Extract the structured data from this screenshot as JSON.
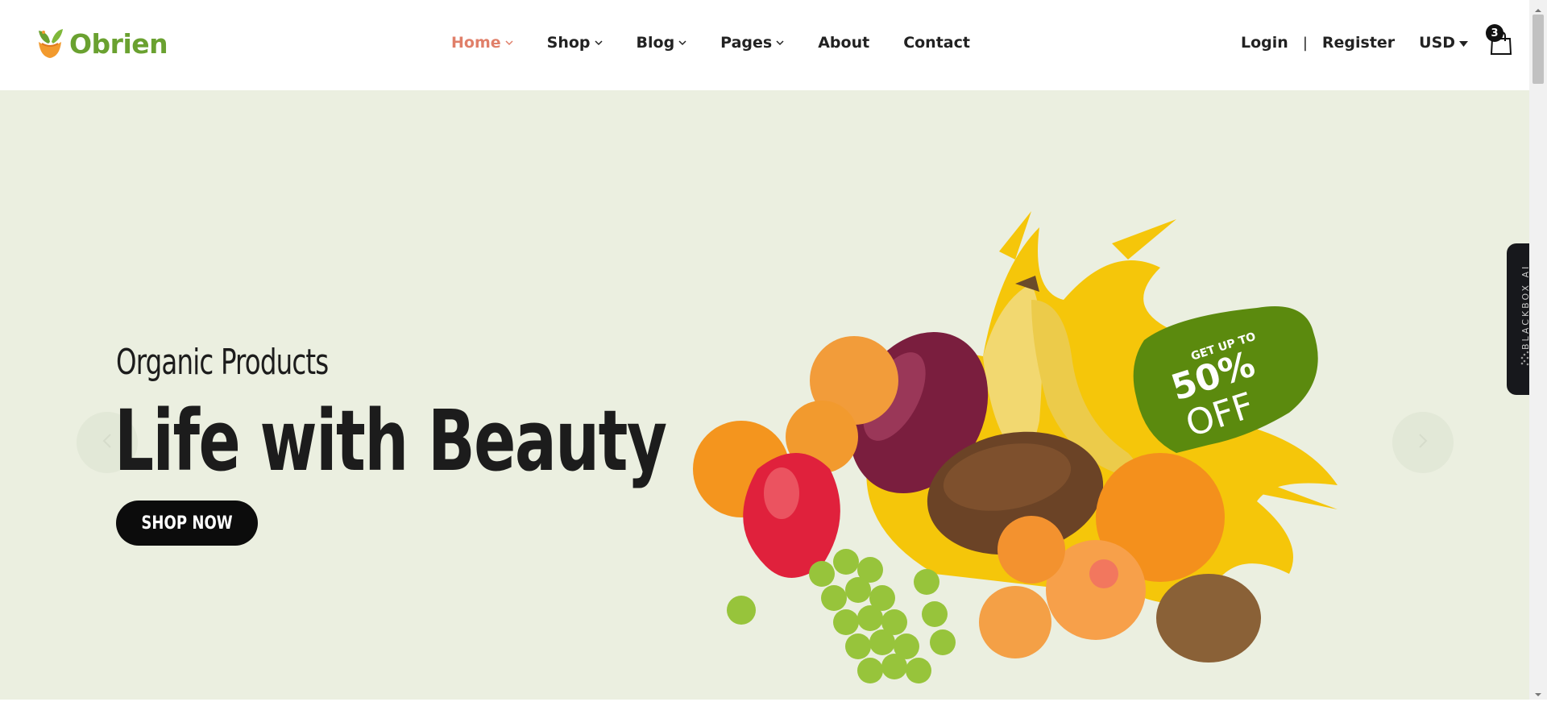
{
  "header": {
    "logo_text": "Obrien",
    "nav": [
      {
        "label": "Home",
        "has_dropdown": true,
        "active": true
      },
      {
        "label": "Shop",
        "has_dropdown": true,
        "active": false
      },
      {
        "label": "Blog",
        "has_dropdown": true,
        "active": false
      },
      {
        "label": "Pages",
        "has_dropdown": true,
        "active": false
      },
      {
        "label": "About",
        "has_dropdown": false,
        "active": false
      },
      {
        "label": "Contact",
        "has_dropdown": false,
        "active": false
      }
    ],
    "login_label": "Login",
    "separator": "|",
    "register_label": "Register",
    "currency": "USD",
    "cart_count": "3"
  },
  "hero": {
    "subtitle": "Organic Products",
    "title": "Life with Beauty",
    "cta_label": "SHOP NOW",
    "promo_line1": "GET UP TO",
    "promo_line2": "50%",
    "promo_line3": "OFF"
  },
  "side_tab": {
    "label": "BLACKBOX AI"
  },
  "colors": {
    "accent_active": "#e07f69",
    "brand_green": "#6aa130",
    "hero_bg": "#ebefe0",
    "promo_green": "#5b8a0e",
    "splash_yellow": "#f5c60a"
  },
  "icons": [
    "leaf-logo-icon",
    "chevron-down-icon",
    "caret-down-icon",
    "shopping-bag-icon",
    "arrow-left-icon",
    "arrow-right-icon",
    "sparkle-dots-icon"
  ]
}
